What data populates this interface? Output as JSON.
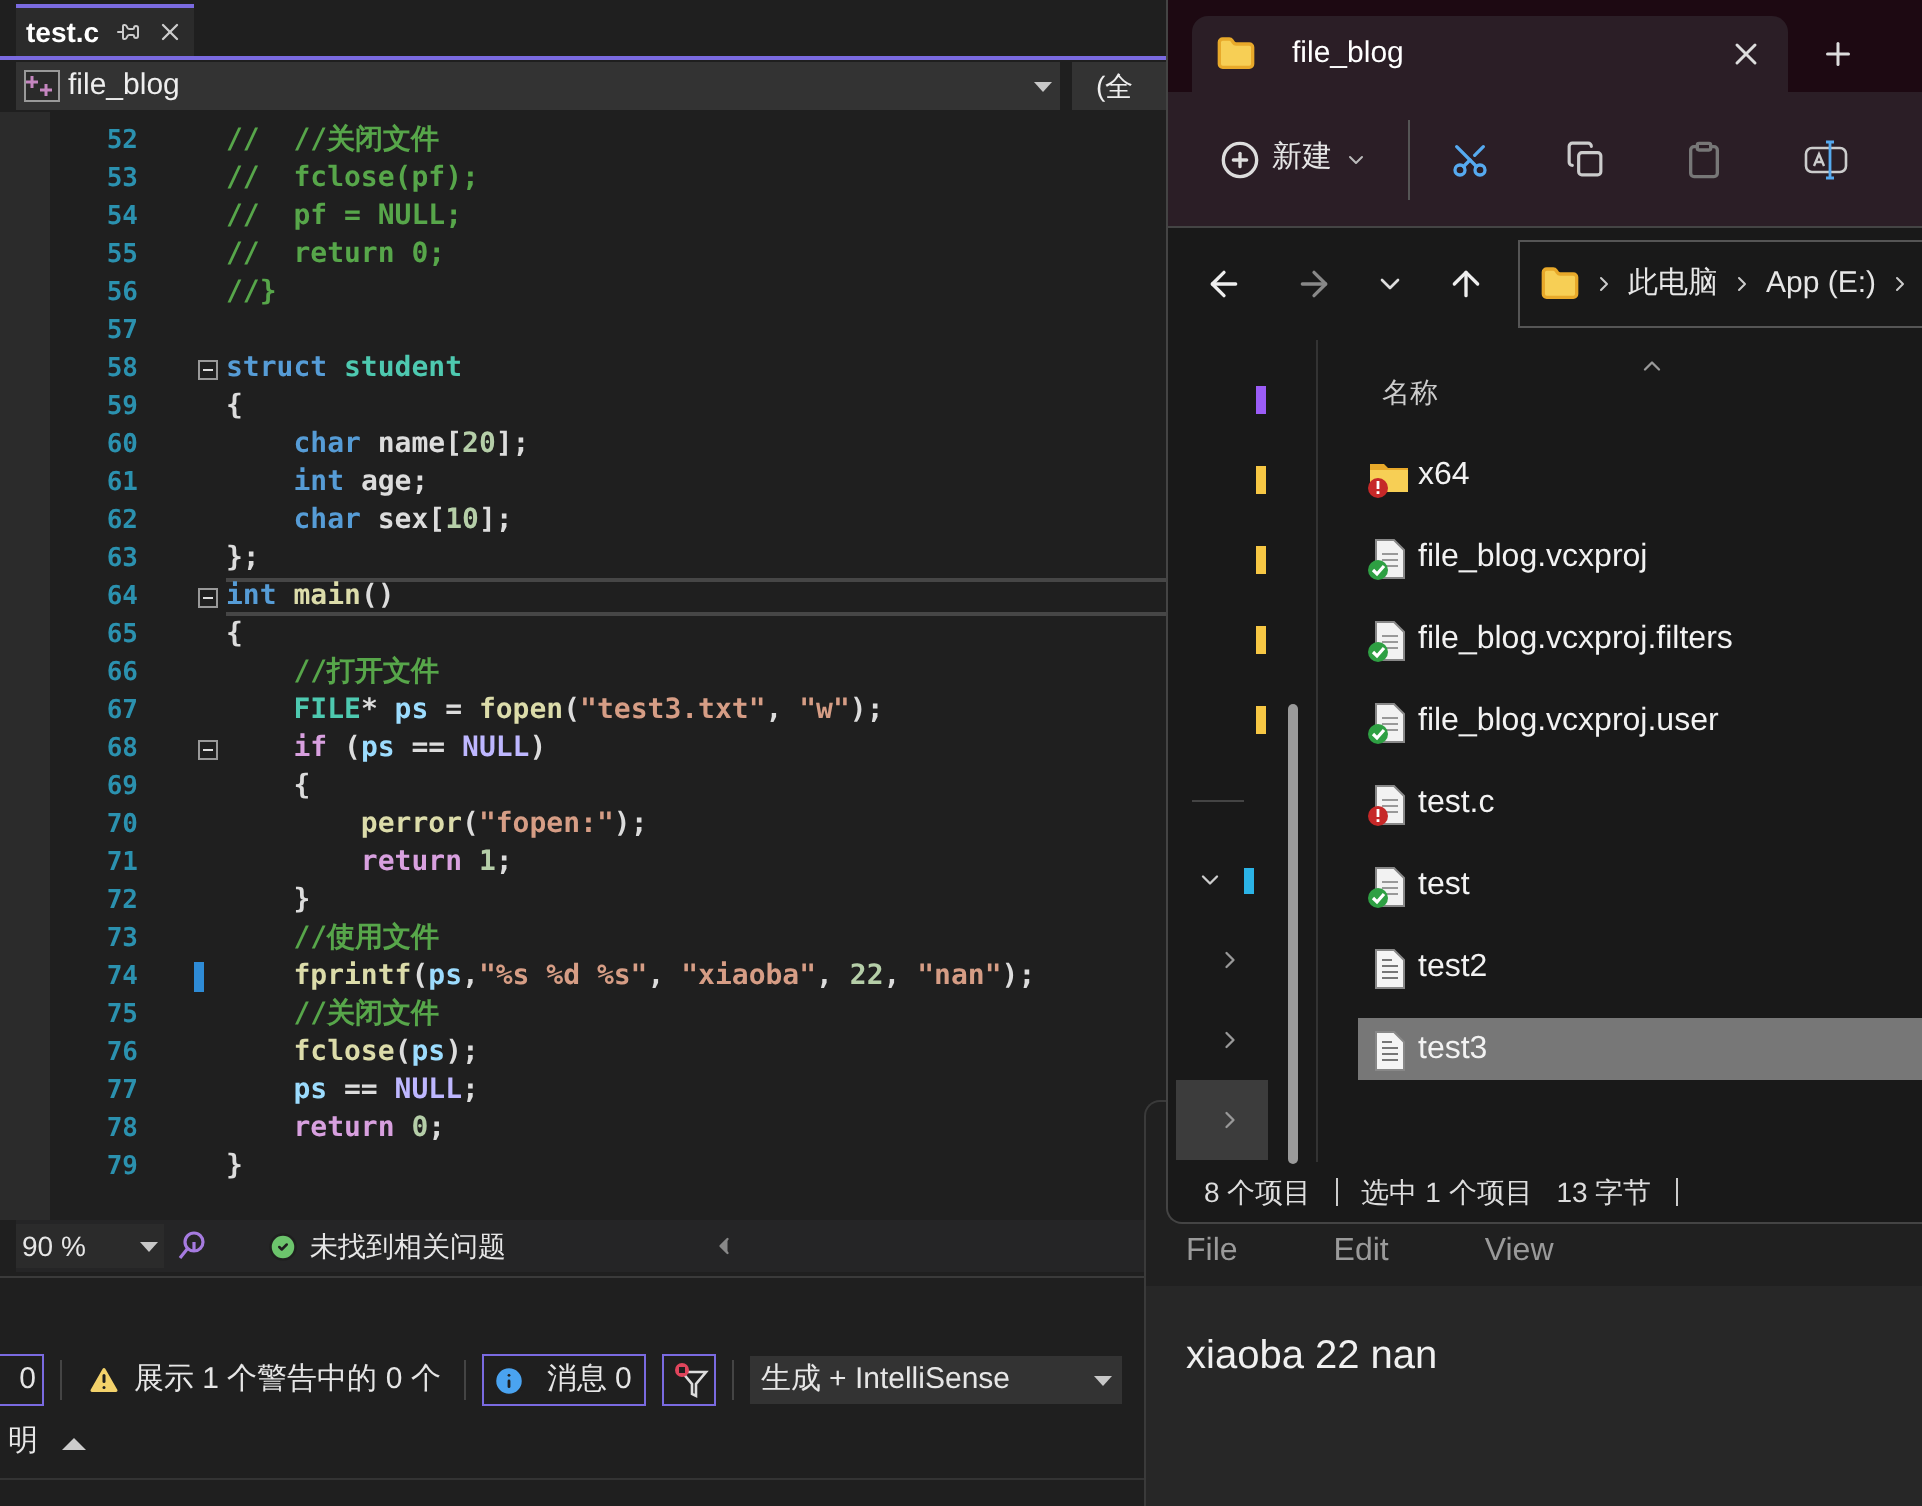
{
  "editor": {
    "tabs": [
      {
        "label": "test.c",
        "selected": true
      }
    ],
    "project_dropdown": {
      "value": "file_blog"
    },
    "scope_dropdown": {
      "value": "(全"
    },
    "lines": [
      {
        "number": "52",
        "fold": false,
        "modified": false,
        "current": false,
        "tokens": [
          {
            "kind": "comment",
            "text": "//  //关闭文件"
          }
        ]
      },
      {
        "number": "53",
        "fold": false,
        "modified": false,
        "current": false,
        "tokens": [
          {
            "kind": "comment",
            "text": "//  fclose(pf);"
          }
        ]
      },
      {
        "number": "54",
        "fold": false,
        "modified": false,
        "current": false,
        "tokens": [
          {
            "kind": "comment",
            "text": "//  pf = NULL;"
          }
        ]
      },
      {
        "number": "55",
        "fold": false,
        "modified": false,
        "current": false,
        "tokens": [
          {
            "kind": "comment",
            "text": "//  return 0;"
          }
        ]
      },
      {
        "number": "56",
        "fold": false,
        "modified": false,
        "current": false,
        "tokens": [
          {
            "kind": "comment",
            "text": "//}"
          }
        ]
      },
      {
        "number": "57",
        "fold": false,
        "modified": false,
        "current": false
      },
      {
        "number": "58",
        "fold": true,
        "modified": false,
        "current": false,
        "tokens": [
          {
            "kind": "keyword",
            "text": "struct"
          },
          {
            "kind": "type",
            "text": " student"
          }
        ]
      },
      {
        "number": "59",
        "fold": false,
        "modified": false,
        "current": false,
        "tokens": [
          {
            "kind": "plain",
            "text": "{"
          }
        ]
      },
      {
        "number": "60",
        "fold": false,
        "modified": false,
        "current": false,
        "tokens": [
          {
            "kind": "keyword",
            "text": "    char"
          },
          {
            "kind": "plain",
            "text": " name["
          },
          {
            "kind": "number",
            "text": "20"
          },
          {
            "kind": "plain",
            "text": "];"
          }
        ]
      },
      {
        "number": "61",
        "fold": false,
        "modified": false,
        "current": false,
        "tokens": [
          {
            "kind": "keyword",
            "text": "    int"
          },
          {
            "kind": "plain",
            "text": " age;"
          }
        ]
      },
      {
        "number": "62",
        "fold": false,
        "modified": false,
        "current": false,
        "tokens": [
          {
            "kind": "keyword",
            "text": "    char"
          },
          {
            "kind": "plain",
            "text": " sex["
          },
          {
            "kind": "number",
            "text": "10"
          },
          {
            "kind": "plain",
            "text": "];"
          }
        ]
      },
      {
        "number": "63",
        "fold": false,
        "modified": false,
        "current": false,
        "tokens": [
          {
            "kind": "plain",
            "text": "};"
          }
        ]
      },
      {
        "number": "64",
        "fold": true,
        "modified": false,
        "current": true,
        "tokens": [
          {
            "kind": "keyword",
            "text": "int"
          },
          {
            "kind": "function",
            "text": " main"
          },
          {
            "kind": "plain",
            "text": "()"
          }
        ]
      },
      {
        "number": "65",
        "fold": false,
        "modified": false,
        "current": false,
        "tokens": [
          {
            "kind": "plain",
            "text": "{"
          }
        ]
      },
      {
        "number": "66",
        "fold": false,
        "modified": false,
        "current": false,
        "tokens": [
          {
            "kind": "comment",
            "text": "    //打开文件"
          }
        ]
      },
      {
        "number": "67",
        "fold": false,
        "modified": false,
        "current": false,
        "tokens": [
          {
            "kind": "type",
            "text": "    FILE"
          },
          {
            "kind": "plain",
            "text": "* "
          },
          {
            "kind": "variable",
            "text": "ps"
          },
          {
            "kind": "plain",
            "text": " = "
          },
          {
            "kind": "function",
            "text": "fopen"
          },
          {
            "kind": "plain",
            "text": "("
          },
          {
            "kind": "string",
            "text": "\"test3.txt\""
          },
          {
            "kind": "plain",
            "text": ", "
          },
          {
            "kind": "string",
            "text": "\"w\""
          },
          {
            "kind": "plain",
            "text": ");"
          }
        ]
      },
      {
        "number": "68",
        "fold": true,
        "modified": false,
        "current": false,
        "tokens": [
          {
            "kind": "control",
            "text": "    if"
          },
          {
            "kind": "plain",
            "text": " ("
          },
          {
            "kind": "variable",
            "text": "ps"
          },
          {
            "kind": "plain",
            "text": " == "
          },
          {
            "kind": "macro",
            "text": "NULL"
          },
          {
            "kind": "plain",
            "text": ")"
          }
        ]
      },
      {
        "number": "69",
        "fold": false,
        "modified": false,
        "current": false,
        "tokens": [
          {
            "kind": "plain",
            "text": "    {"
          }
        ]
      },
      {
        "number": "70",
        "fold": false,
        "modified": false,
        "current": false,
        "tokens": [
          {
            "kind": "function",
            "text": "        perror"
          },
          {
            "kind": "plain",
            "text": "("
          },
          {
            "kind": "string",
            "text": "\"fopen:\""
          },
          {
            "kind": "plain",
            "text": ");"
          }
        ]
      },
      {
        "number": "71",
        "fold": false,
        "modified": false,
        "current": false,
        "tokens": [
          {
            "kind": "control",
            "text": "        return"
          },
          {
            "kind": "number",
            "text": " 1"
          },
          {
            "kind": "plain",
            "text": ";"
          }
        ]
      },
      {
        "number": "72",
        "fold": false,
        "modified": false,
        "current": false,
        "tokens": [
          {
            "kind": "plain",
            "text": "    }"
          }
        ]
      },
      {
        "number": "73",
        "fold": false,
        "modified": false,
        "current": false,
        "tokens": [
          {
            "kind": "comment",
            "text": "    //使用文件"
          }
        ]
      },
      {
        "number": "74",
        "fold": false,
        "modified": true,
        "current": false,
        "tokens": [
          {
            "kind": "function",
            "text": "    fprintf"
          },
          {
            "kind": "plain",
            "text": "("
          },
          {
            "kind": "variable",
            "text": "ps"
          },
          {
            "kind": "plain",
            "text": ","
          },
          {
            "kind": "string",
            "text": "\"%s %d %s\""
          },
          {
            "kind": "plain",
            "text": ", "
          },
          {
            "kind": "string",
            "text": "\"xiaoba\""
          },
          {
            "kind": "plain",
            "text": ", "
          },
          {
            "kind": "number",
            "text": "22"
          },
          {
            "kind": "plain",
            "text": ", "
          },
          {
            "kind": "string",
            "text": "\"nan\""
          },
          {
            "kind": "plain",
            "text": ");"
          }
        ]
      },
      {
        "number": "75",
        "fold": false,
        "modified": false,
        "current": false,
        "tokens": [
          {
            "kind": "comment",
            "text": "    //关闭文件"
          }
        ]
      },
      {
        "number": "76",
        "fold": false,
        "modified": false,
        "current": false,
        "tokens": [
          {
            "kind": "function",
            "text": "    fclose"
          },
          {
            "kind": "plain",
            "text": "("
          },
          {
            "kind": "variable",
            "text": "ps"
          },
          {
            "kind": "plain",
            "text": ");"
          }
        ]
      },
      {
        "number": "77",
        "fold": false,
        "modified": false,
        "current": false,
        "tokens": [
          {
            "kind": "variable",
            "text": "    ps"
          },
          {
            "kind": "plain",
            "text": " == "
          },
          {
            "kind": "macro",
            "text": "NULL"
          },
          {
            "kind": "plain",
            "text": ";"
          }
        ]
      },
      {
        "number": "78",
        "fold": false,
        "modified": false,
        "current": false,
        "tokens": [
          {
            "kind": "control",
            "text": "    return"
          },
          {
            "kind": "number",
            "text": " 0"
          },
          {
            "kind": "plain",
            "text": ";"
          }
        ]
      },
      {
        "number": "79",
        "fold": false,
        "modified": false,
        "current": false,
        "tokens": [
          {
            "kind": "plain",
            "text": "}"
          }
        ]
      }
    ],
    "status": {
      "zoom": "90 %",
      "issues": "未找到相关问题"
    }
  },
  "error_list": {
    "errors_button": {
      "label": "0",
      "selected": true
    },
    "warnings_button": {
      "label": "展示 1 个警告中的 0 个",
      "selected": false
    },
    "messages_button": {
      "label": "消息 0",
      "selected": true
    },
    "filter_button": {
      "selected": true
    },
    "build_dropdown": {
      "value": "生成 + IntelliSense"
    },
    "column": "明"
  },
  "explorer": {
    "tabs": [
      {
        "label": "file_blog",
        "selected": true
      }
    ],
    "toolbar": {
      "new_button": "新建"
    },
    "breadcrumb": [
      "此电脑",
      "App (E:)"
    ],
    "nav_items": [
      {
        "kind": "shortcut",
        "color": "#9b5cf6"
      },
      {
        "kind": "shortcut",
        "color": "#f6c744"
      },
      {
        "kind": "shortcut",
        "color": "#f6c744"
      },
      {
        "kind": "shortcut",
        "color": "#f6c744"
      },
      {
        "kind": "shortcut",
        "color": "#f6c744"
      },
      {
        "kind": "divider"
      },
      {
        "kind": "node",
        "expanded": true,
        "selected": false,
        "color": "#2bb3e6"
      },
      {
        "kind": "node",
        "expanded": false,
        "selected": false
      },
      {
        "kind": "node",
        "expanded": false,
        "selected": false
      },
      {
        "kind": "node",
        "expanded": false,
        "selected": true
      }
    ],
    "column": "名称",
    "files": [
      {
        "name": "x64",
        "kind": "folder",
        "error": true,
        "checked_in": false,
        "selected": false
      },
      {
        "name": "file_blog.vcxproj",
        "kind": "document",
        "error": false,
        "checked_in": true,
        "selected": false
      },
      {
        "name": "file_blog.vcxproj.filters",
        "kind": "document",
        "error": false,
        "checked_in": true,
        "selected": false
      },
      {
        "name": "file_blog.vcxproj.user",
        "kind": "document",
        "error": false,
        "checked_in": true,
        "selected": false
      },
      {
        "name": "test.c",
        "kind": "document",
        "error": true,
        "checked_in": false,
        "selected": false
      },
      {
        "name": "test",
        "kind": "document",
        "error": false,
        "checked_in": true,
        "selected": false
      },
      {
        "name": "test2",
        "kind": "text",
        "error": false,
        "checked_in": false,
        "selected": false
      },
      {
        "name": "test3",
        "kind": "text",
        "error": false,
        "checked_in": false,
        "selected": true
      }
    ],
    "status_bar": {
      "count": "8 个项目",
      "selection": "选中 1 个项目",
      "size": "13 字节"
    }
  },
  "notepad": {
    "menu": [
      "File",
      "Edit",
      "View"
    ],
    "content": "xiaoba 22 nan"
  }
}
